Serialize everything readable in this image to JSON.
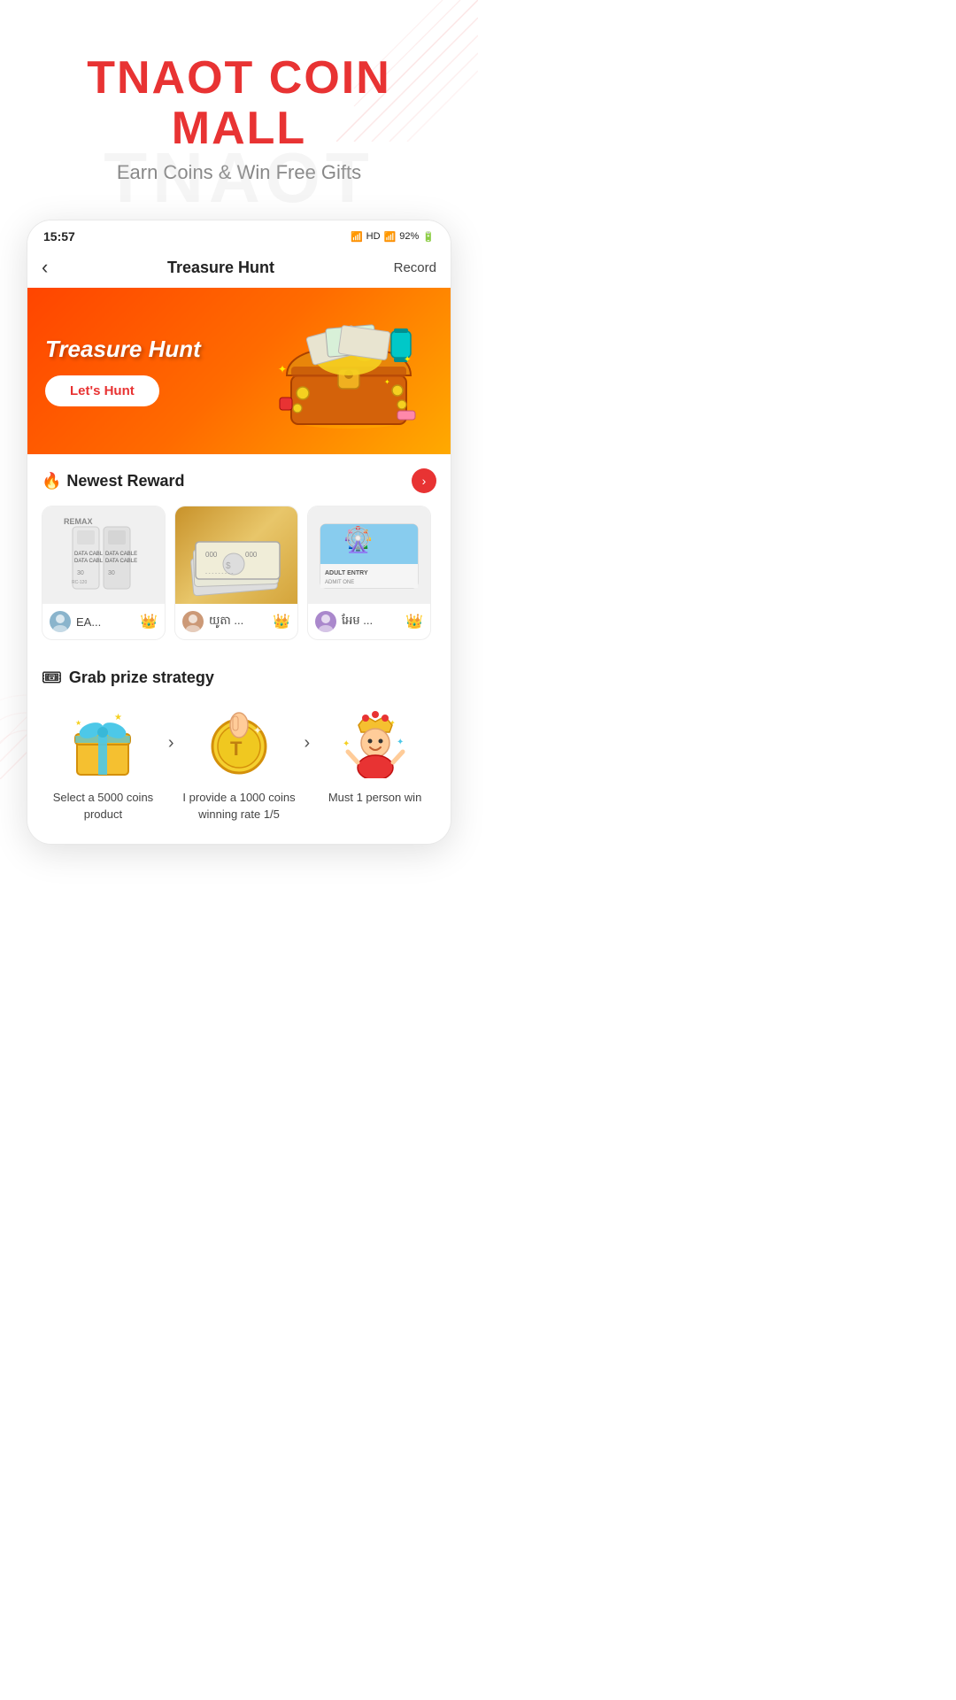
{
  "app": {
    "title": "TNAOT COIN MALL",
    "subtitle": "Earn Coins & Win Free Gifts",
    "watermark": "TNAOT"
  },
  "status_bar": {
    "time": "15:57",
    "battery": "92%",
    "signal": "HD"
  },
  "nav": {
    "title": "Treasure Hunt",
    "record_label": "Record",
    "back_icon": "‹"
  },
  "banner": {
    "title": "Treasure Hunt",
    "button_label": "Let's Hunt"
  },
  "newest_reward": {
    "section_icon": "🔥",
    "section_title": "Newest Reward",
    "more_icon": "›",
    "items": [
      {
        "user_name": "EA...",
        "avatar_color": "#8ab4cc"
      },
      {
        "user_name": "យូតា ...",
        "avatar_color": "#cc9977"
      },
      {
        "user_name": "អែម ...",
        "avatar_color": "#aa88cc"
      }
    ]
  },
  "strategy": {
    "section_icon": "🎟",
    "section_title": "Grab prize strategy",
    "steps": [
      {
        "id": 1,
        "icon_type": "gift",
        "label": "Select a 5000 coins product"
      },
      {
        "id": 2,
        "icon_type": "coin",
        "label": "I provide a 1000 coins winning rate 1/5"
      },
      {
        "id": 3,
        "icon_type": "winner",
        "label": "Must 1 person win"
      }
    ],
    "arrow": "›"
  }
}
